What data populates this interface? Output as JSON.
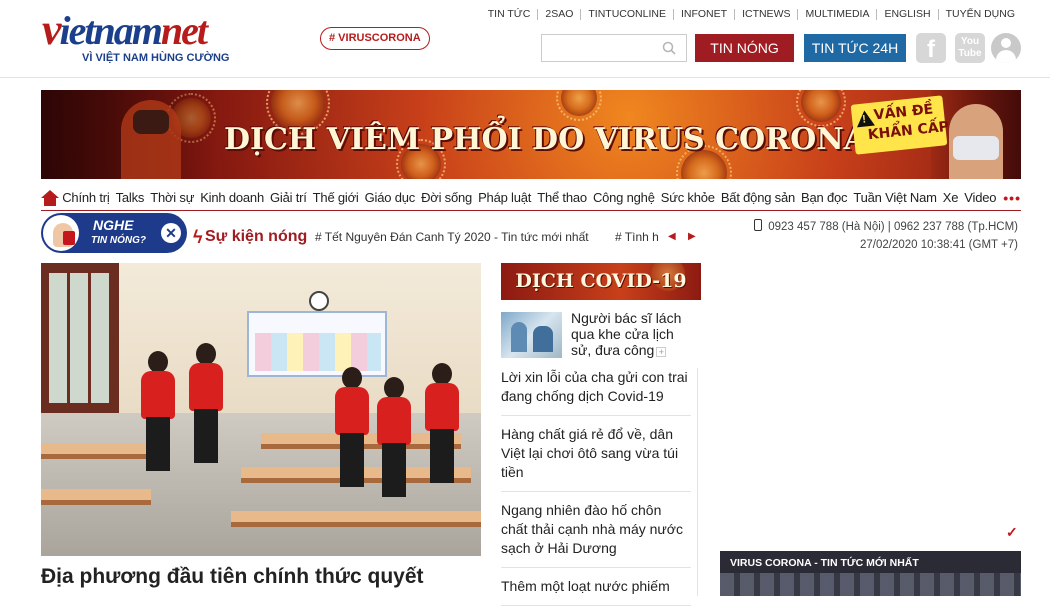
{
  "header": {
    "logo": {
      "v": "v",
      "i": "i",
      "etnam": "etnam",
      "net": "net",
      "tagline": "VÌ VIỆT NAM HÙNG CƯỜNG"
    },
    "hashtag": "# VIRUSCORONA",
    "top_links": [
      "TIN TỨC",
      "2SAO",
      "TINTUCONLINE",
      "INFONET",
      "ICTNEWS",
      "MULTIMEDIA",
      "ENGLISH",
      "TUYỂN DỤNG"
    ],
    "search": {
      "value": "",
      "placeholder": ""
    },
    "btn_hot": "TIN NÓNG",
    "btn_24h": "TIN TỨC 24H",
    "youtube_label": "You Tube"
  },
  "banner": {
    "title": "DỊCH VIÊM PHỔI DO VIRUS CORONA",
    "badge_line1": "VẤN ĐỀ",
    "badge_line2": "KHẨN CẤP"
  },
  "nav": {
    "categories": [
      "Chính trị",
      "Talks",
      "Thời sự",
      "Kinh doanh",
      "Giải trí",
      "Thế giới",
      "Giáo dục",
      "Đời sống",
      "Pháp luật",
      "Thể thao",
      "Công nghệ",
      "Sức khỏe",
      "Bất động sản",
      "Bạn đọc",
      "Tuần Việt Nam",
      "Xe",
      "Video"
    ],
    "more": "•••"
  },
  "hot_events": {
    "nghe_line1": "NGHE",
    "nghe_line2": "TIN NÓNG?",
    "label": "Sự kiện nóng",
    "topics": [
      "# Tết Nguyên Đán Canh Tý 2020 - Tin tức mới nhất",
      "# Tình h"
    ]
  },
  "contact": {
    "phones": "0923 457 788 (Hà Nội) | 0962 237 788 (Tp.HCM)",
    "datetime": "27/02/2020 10:38:41 (GMT +7)"
  },
  "main": {
    "headline": "Địa phương đầu tiên chính thức quyết"
  },
  "covid": {
    "title": "DỊCH COVID-19",
    "featured": "Người bác sĩ lách qua khe cửa lịch sử, đưa công",
    "items": [
      "Lời xin lỗi của cha gửi con trai đang chống dịch Covid-19",
      "Hàng chất giá rẻ đổ về, dân Việt lại chơi ôtô sang vừa túi tiền",
      "Ngang nhiên đào hố chôn chất thải cạnh nhà máy nước sạch ở Hải Dương",
      "Thêm một loạt nước phiếm"
    ]
  },
  "sidebar": {
    "virus_box_title": "VIRUS CORONA - TIN TỨC MỚI NHẤT"
  },
  "colors": {
    "brand_red": "#9e1c22",
    "brand_blue": "#1f6aa5",
    "logo_blue": "#1b3f8b"
  }
}
